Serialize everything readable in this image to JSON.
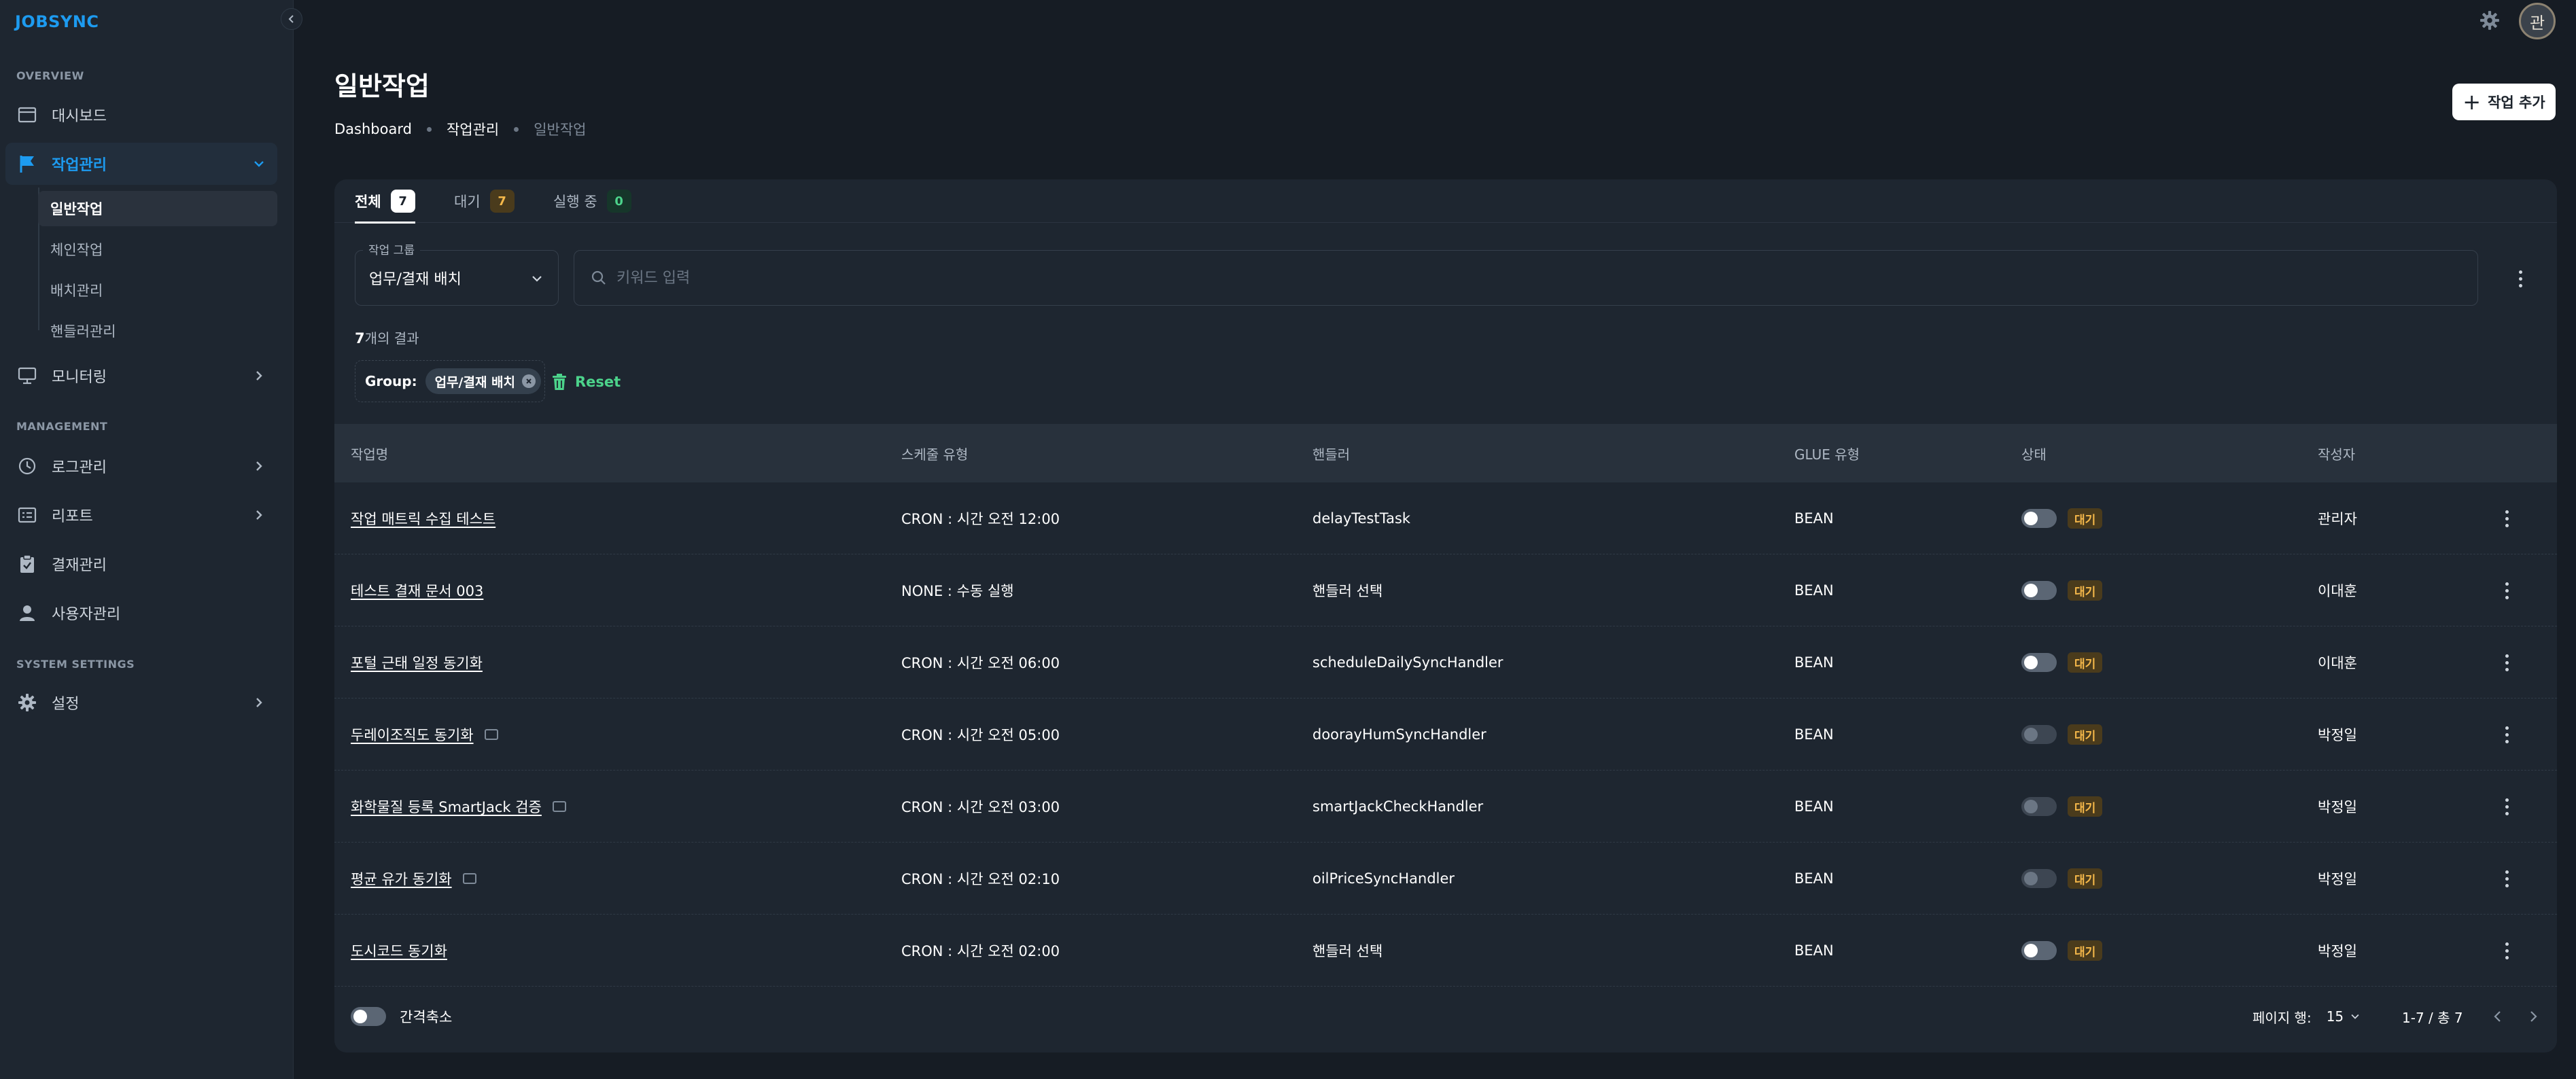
{
  "app": {
    "logo": "JOBSYNC"
  },
  "sidebar": {
    "sections": {
      "overview": "OVERVIEW",
      "management": "MANAGEMENT",
      "system": "SYSTEM SETTINGS"
    },
    "items": {
      "dashboard": "대시보드",
      "job_mgmt": "작업관리",
      "monitoring": "모니터링",
      "log_mgmt": "로그관리",
      "report": "리포트",
      "approval": "결재관리",
      "users": "사용자관리",
      "settings": "설정"
    },
    "sub_items": [
      "일반작업",
      "체인작업",
      "배치관리",
      "핸들러관리"
    ]
  },
  "topbar": {
    "avatar_initial": "관"
  },
  "page": {
    "title": "일반작업",
    "breadcrumb": [
      "Dashboard",
      "작업관리",
      "일반작업"
    ],
    "add_button": "작업 추가"
  },
  "tabs": [
    {
      "label": "전체",
      "count": "7"
    },
    {
      "label": "대기",
      "count": "7"
    },
    {
      "label": "실행 중",
      "count": "0"
    }
  ],
  "filters": {
    "group_label": "작업 그룹",
    "group_value": "업무/결재 배치",
    "search_placeholder": "키워드 입력",
    "result_count": "7",
    "result_suffix": "개의 결과",
    "chip_group_label": "Group:",
    "chip_value": "업무/결재 배치",
    "reset_label": "Reset"
  },
  "table": {
    "columns": [
      "작업명",
      "스케줄 유형",
      "핸들러",
      "GLUE 유형",
      "상태",
      "작성자"
    ],
    "rows": [
      {
        "name": "작업 매트릭 수집 테스트",
        "schedule": "CRON : 시간 오전 12:00",
        "handler": "delayTestTask",
        "glue": "BEAN",
        "status": "대기",
        "author": "관리자",
        "ext": false,
        "enabled": true
      },
      {
        "name": "테스트 결재 문서 003",
        "schedule": "NONE : 수동 실행",
        "handler": "핸들러 선택",
        "glue": "BEAN",
        "status": "대기",
        "author": "이대훈",
        "ext": false,
        "enabled": true
      },
      {
        "name": "포털 근태 일정 동기화",
        "schedule": "CRON : 시간 오전 06:00",
        "handler": "scheduleDailySyncHandler",
        "glue": "BEAN",
        "status": "대기",
        "author": "이대훈",
        "ext": false,
        "enabled": true
      },
      {
        "name": "두레이조직도 동기화",
        "schedule": "CRON : 시간 오전 05:00",
        "handler": "doorayHumSyncHandler",
        "glue": "BEAN",
        "status": "대기",
        "author": "박정일",
        "ext": true,
        "enabled": false
      },
      {
        "name": "화학물질 등록 SmartJack 검증",
        "schedule": "CRON : 시간 오전 03:00",
        "handler": "smartJackCheckHandler",
        "glue": "BEAN",
        "status": "대기",
        "author": "박정일",
        "ext": true,
        "enabled": false
      },
      {
        "name": "평균 유가 동기화",
        "schedule": "CRON : 시간 오전 02:10",
        "handler": "oilPriceSyncHandler",
        "glue": "BEAN",
        "status": "대기",
        "author": "박정일",
        "ext": true,
        "enabled": false
      },
      {
        "name": "도시코드 동기화",
        "schedule": "CRON : 시간 오전 02:00",
        "handler": "핸들러 선택",
        "glue": "BEAN",
        "status": "대기",
        "author": "박정일",
        "ext": false,
        "enabled": true
      }
    ]
  },
  "footer": {
    "dense_label": "간격축소",
    "rows_per_page_label": "페이지 행:",
    "rows_per_page": "15",
    "range": "1-7 / 총 7"
  },
  "colors": {
    "accent": "#1d9bf0",
    "waiting": "#f5b84a",
    "running": "#4cd38b",
    "reset": "#4cd38b"
  }
}
